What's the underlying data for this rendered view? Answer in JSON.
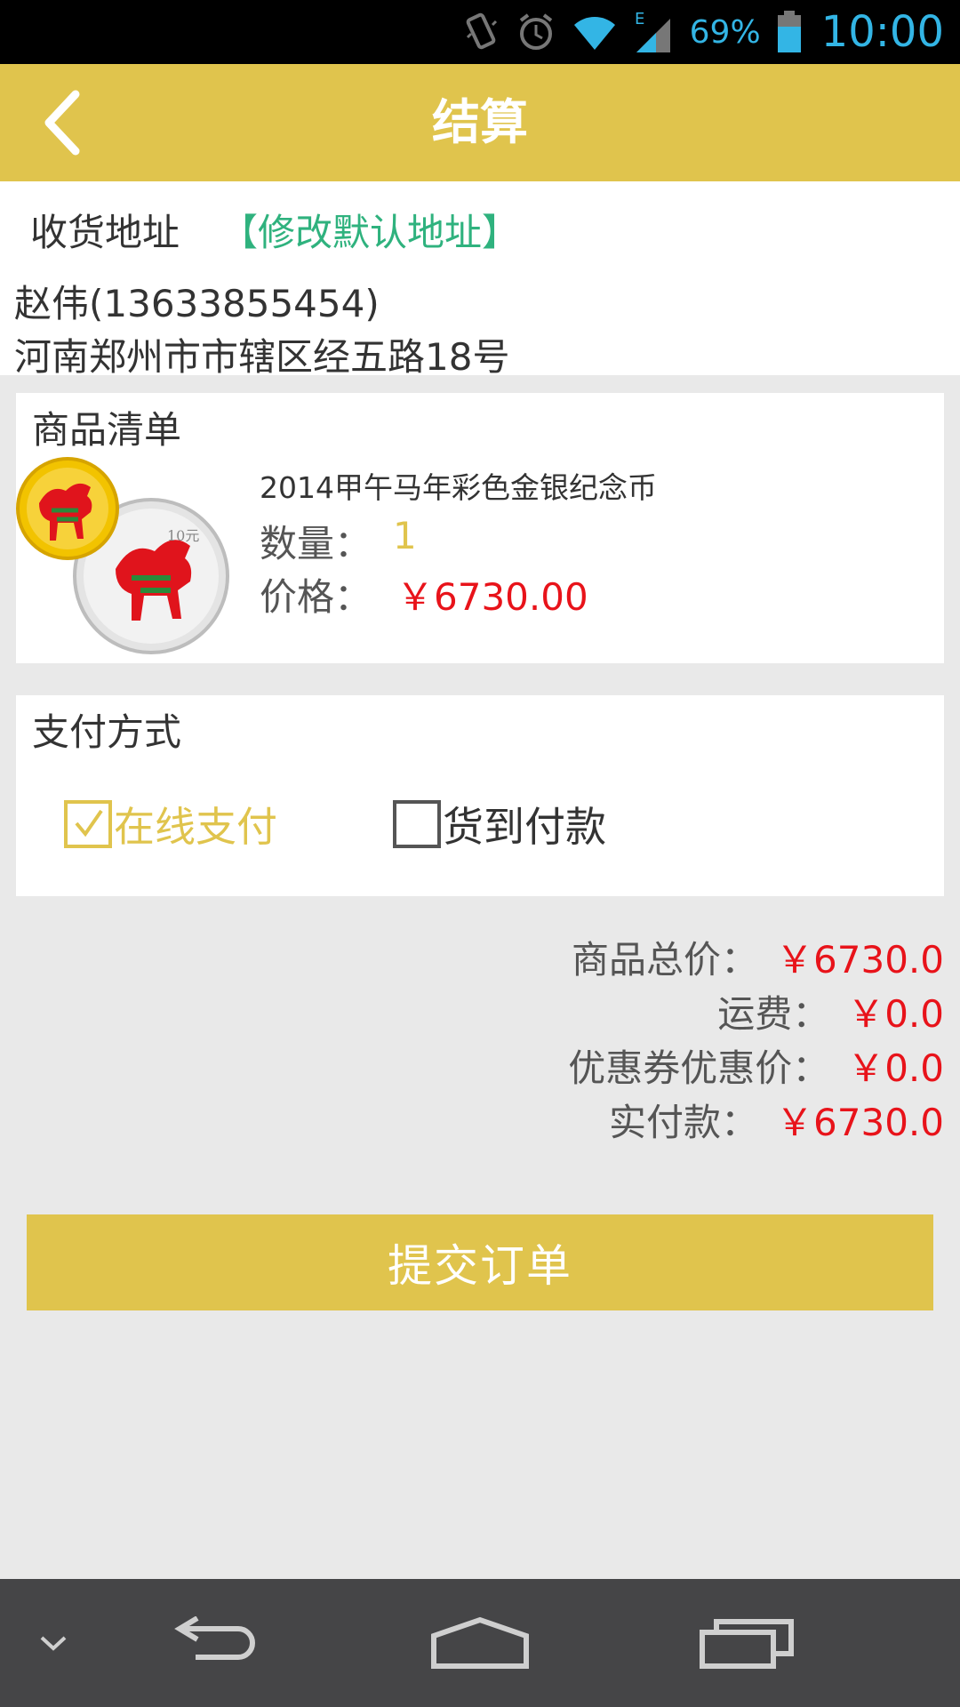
{
  "status_bar": {
    "battery": "69%",
    "time": "10:00",
    "icons": [
      "vibrate-icon",
      "alarm-icon",
      "wifi-icon",
      "signal-icon",
      "battery-icon"
    ]
  },
  "header": {
    "title": "结算",
    "back_icon": "chevron-left-icon"
  },
  "address": {
    "label": "收货地址",
    "edit_link": "【修改默认地址】",
    "name_phone": "赵伟(13633855454)",
    "line": "河南郑州市市辖区经五路18号"
  },
  "product_list": {
    "title": "商品清单",
    "item": {
      "name": "2014甲午马年彩色金银纪念币",
      "qty_label": "数量：",
      "qty": "1",
      "price_label": "价格：",
      "price": "￥6730.00"
    }
  },
  "payment": {
    "title": "支付方式",
    "options": [
      {
        "label": "在线支付",
        "checked": true
      },
      {
        "label": "货到付款",
        "checked": false
      }
    ]
  },
  "summary": [
    {
      "label": "商品总价：",
      "value": "￥6730.0"
    },
    {
      "label": "运费：",
      "value": "￥0.0"
    },
    {
      "label": "优惠券优惠价：",
      "value": "￥0.0"
    },
    {
      "label": "实付款：",
      "value": "￥6730.0"
    }
  ],
  "submit_label": "提交订单",
  "colors": {
    "accent": "#e0c44d",
    "price_red": "#e8131a",
    "link_green": "#2fb27e",
    "nav_bg": "#454547"
  },
  "nav_bar": {
    "icons": [
      "chevron-down-icon",
      "back-icon",
      "home-icon",
      "recents-icon"
    ]
  }
}
